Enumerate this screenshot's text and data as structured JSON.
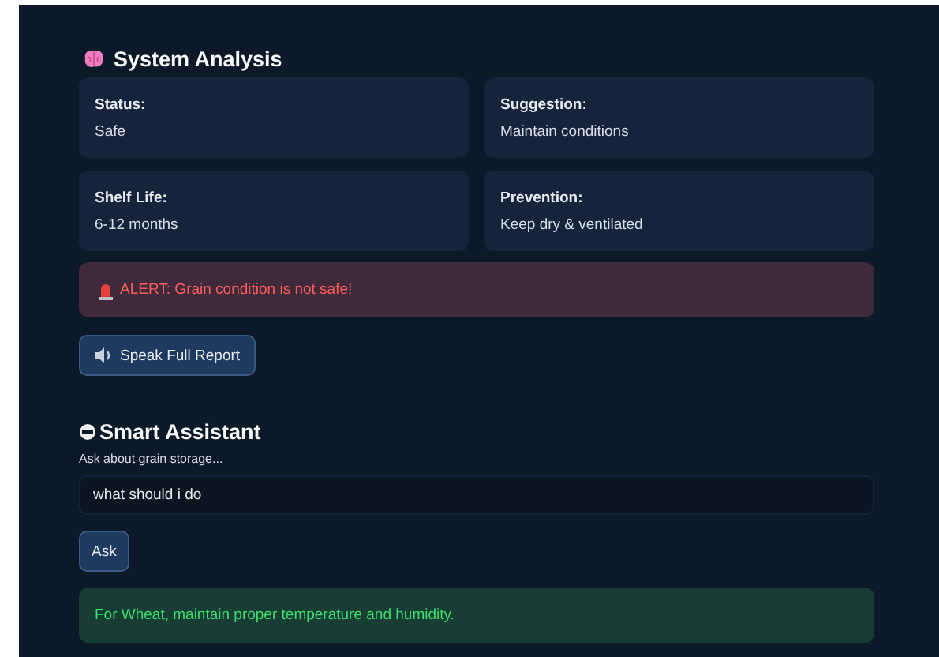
{
  "analysis": {
    "title": "System Analysis",
    "cards": [
      {
        "label": "Status:",
        "value": "Safe"
      },
      {
        "label": "Suggestion:",
        "value": "Maintain conditions"
      },
      {
        "label": "Shelf Life:",
        "value": "6-12 months"
      },
      {
        "label": "Prevention:",
        "value": "Keep dry & ventilated"
      }
    ],
    "alert": "ALERT: Grain condition is not safe!",
    "speak_button": "Speak Full Report"
  },
  "assistant": {
    "title": "Smart Assistant",
    "field_label": "Ask about grain storage...",
    "value": "what should i do",
    "ask_button": "Ask",
    "response": "For Wheat, maintain proper temperature and humidity."
  }
}
